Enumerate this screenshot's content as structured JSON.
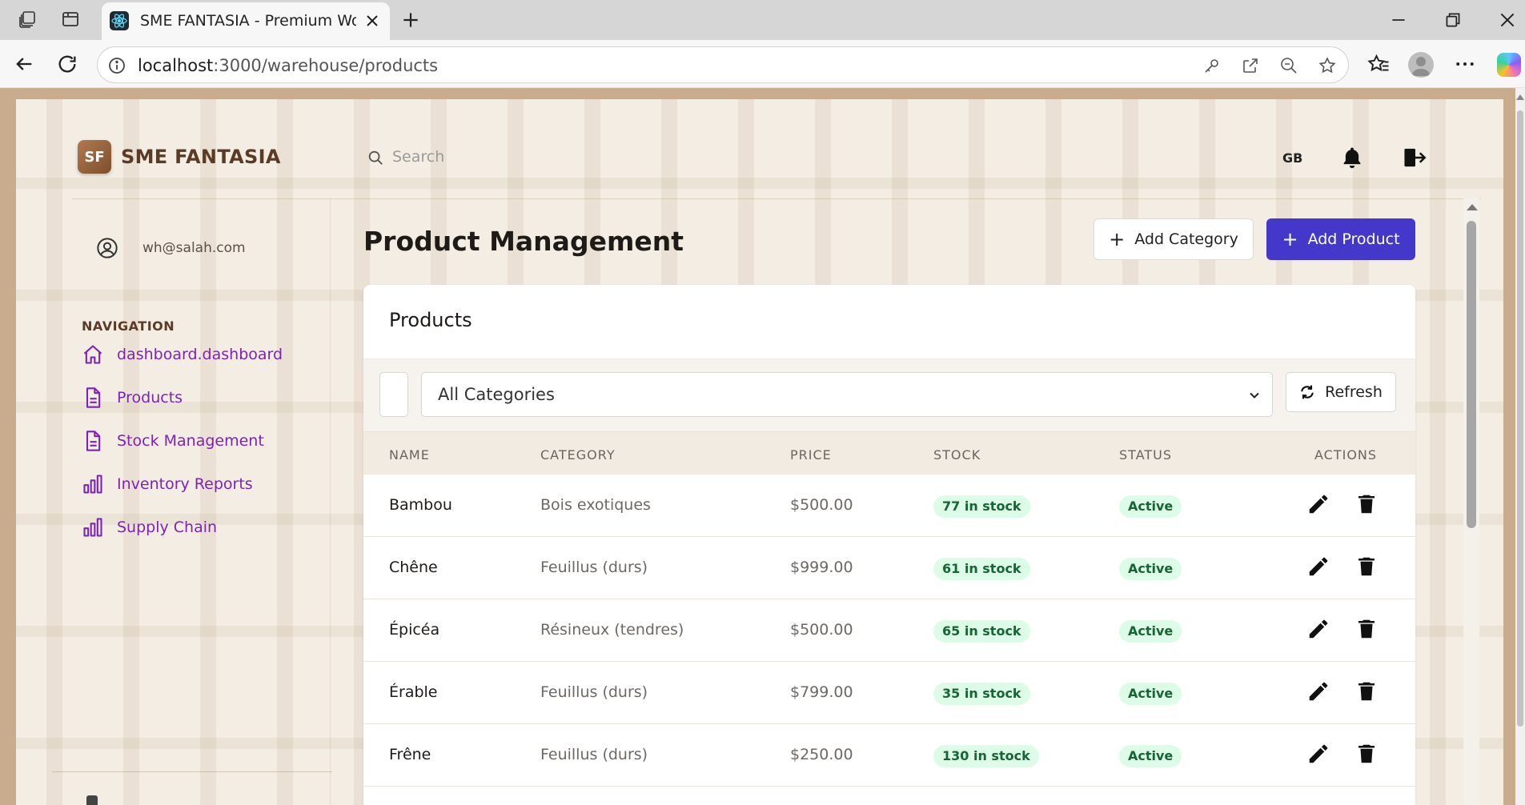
{
  "browser": {
    "tab_title": "SME FANTASIA - Premium Wood",
    "url_host": "localhost",
    "url_path": ":3000/warehouse/products"
  },
  "header": {
    "brand_logo": "SF",
    "brand_name": "SME FANTASIA",
    "search_placeholder": "Search",
    "language": "GB"
  },
  "sidebar": {
    "user_email": "wh@salah.com",
    "nav_heading": "NAVIGATION",
    "items": [
      {
        "label": "dashboard.dashboard",
        "icon": "home-icon"
      },
      {
        "label": "Products",
        "icon": "document-icon"
      },
      {
        "label": "Stock Management",
        "icon": "document-icon"
      },
      {
        "label": "Inventory Reports",
        "icon": "bar-chart-icon"
      },
      {
        "label": "Supply Chain",
        "icon": "bar-chart-icon"
      }
    ]
  },
  "main": {
    "title": "Product Management",
    "add_category_label": "Add Category",
    "add_product_label": "Add Product",
    "card_title": "Products",
    "category_filter": "All Categories",
    "refresh_label": "Refresh",
    "columns": [
      "NAME",
      "CATEGORY",
      "PRICE",
      "STOCK",
      "STATUS",
      "ACTIONS"
    ],
    "rows": [
      {
        "name": "Bambou",
        "category": "Bois exotiques",
        "price": "$500.00",
        "stock": "77 in stock",
        "status": "Active"
      },
      {
        "name": "Chêne",
        "category": "Feuillus (durs)",
        "price": "$999.00",
        "stock": "61 in stock",
        "status": "Active"
      },
      {
        "name": "Épicéa",
        "category": "Résineux (tendres)",
        "price": "$500.00",
        "stock": "65 in stock",
        "status": "Active"
      },
      {
        "name": "Érable",
        "category": "Feuillus (durs)",
        "price": "$799.00",
        "stock": "35 in stock",
        "status": "Active"
      },
      {
        "name": "Frêne",
        "category": "Feuillus (durs)",
        "price": "$250.00",
        "stock": "130 in stock",
        "status": "Active"
      }
    ]
  },
  "colors": {
    "primary_button": "#4338ca",
    "nav_link": "#7e22b8",
    "brand_text": "#5b3a26",
    "badge_bg": "#dcfce7",
    "badge_text": "#166534"
  }
}
